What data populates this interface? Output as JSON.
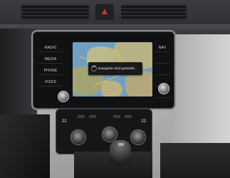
{
  "head_unit": {
    "left_buttons": [
      "RADIO",
      "MEDIA",
      "PHONE",
      "VOICE"
    ],
    "right_buttons": [
      "NAV",
      "",
      "",
      "",
      ""
    ]
  },
  "screen": {
    "toast_text": "Navigation wird gestartet..."
  },
  "climate": {
    "temp_left": "22",
    "temp_right": "22"
  }
}
